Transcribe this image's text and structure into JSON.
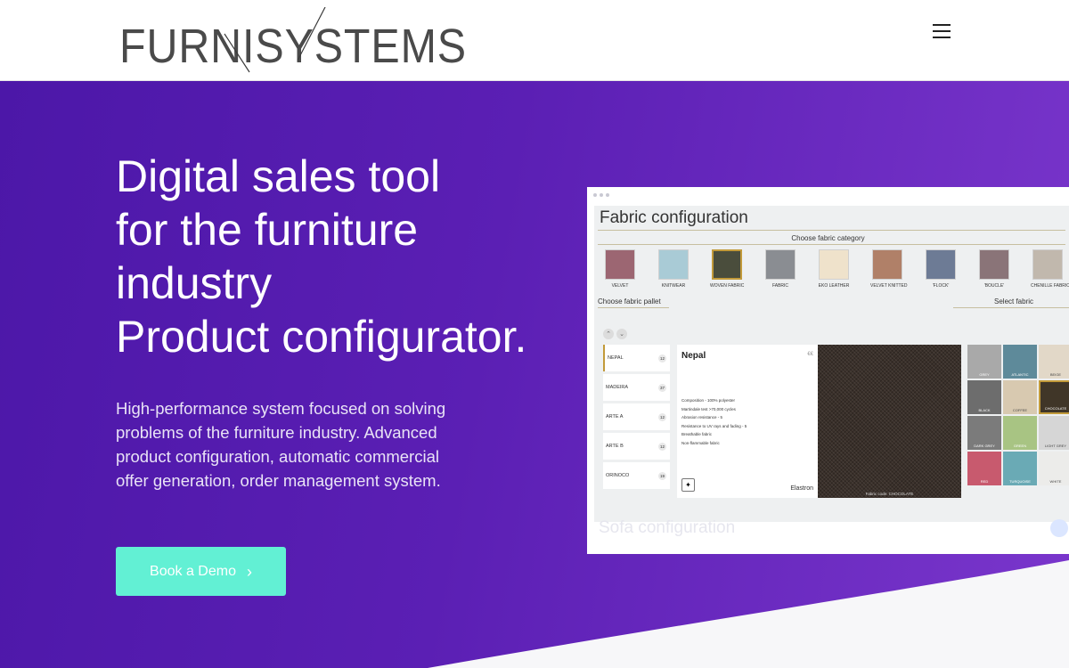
{
  "header": {
    "logo_text": "FURNISYSTEMS",
    "menu_icon": "hamburger-menu-icon"
  },
  "hero": {
    "headline": [
      "Digital sales tool",
      "for the furniture",
      "industry",
      "Product configurator."
    ],
    "description": "High-performance system focused on solving problems of the furniture industry. Advanced product configuration, automatic commercial offer generation, order management system.",
    "cta_label": "Book a Demo",
    "cta_icon": "chevron-right-icon",
    "colors": {
      "gradient_start": "#4c17a8",
      "gradient_end": "#7a36cc",
      "cta": "#62f0d4"
    }
  },
  "mockup": {
    "title": "Fabric configuration",
    "category_title": "Choose fabric category",
    "categories": [
      {
        "label": "VELVET",
        "color": "#9c6672"
      },
      {
        "label": "KNITWEAR",
        "color": "#a9cbd6"
      },
      {
        "label": "WOVEN FABRIC",
        "color": "#4a4d3c"
      },
      {
        "label": "FABRIC",
        "color": "#8a8d92"
      },
      {
        "label": "EKO LEATHER",
        "color": "#efe2cb"
      },
      {
        "label": "VELVET KNITTED",
        "color": "#b08068"
      },
      {
        "label": "'FLOCK'",
        "color": "#6d7b95"
      },
      {
        "label": "'BOUCLE'",
        "color": "#8a7478"
      },
      {
        "label": "CHENILLE FABRIC",
        "color": "#c1b8ad"
      }
    ],
    "pallet_title": "Choose fabric pallet",
    "pallets": [
      {
        "label": "NEPAL",
        "count": "12"
      },
      {
        "label": "MADEIRA",
        "count": "37"
      },
      {
        "label": "ARTE A",
        "count": "12"
      },
      {
        "label": "ARTE B",
        "count": "12"
      },
      {
        "label": "ORINOCO",
        "count": "19"
      }
    ],
    "detail": {
      "name": "Nepal",
      "price": "€€",
      "props": [
        "Composition - 100% polyester",
        "Martindale test >70,000 cycles",
        "Abrasion resistance - 5",
        "Resistance to UV rays and fading - 5",
        "Breathable fabric",
        "Non-flammable fabric"
      ],
      "brand": "Elastron",
      "fabric_caption": "Fabric code: CHOCOLATE"
    },
    "select_title": "Select fabric",
    "swatches": [
      {
        "label": "GREY",
        "color": "#a9a9a9"
      },
      {
        "label": "ATLANTIC",
        "color": "#5e8a9a"
      },
      {
        "label": "BEIGE",
        "color": "#e2d8c8"
      },
      {
        "label": "BLACK",
        "color": "#6d6d6d"
      },
      {
        "label": "COFFEE",
        "color": "#d8c9b0"
      },
      {
        "label": "CHOCOLATE",
        "color": "#403628"
      },
      {
        "label": "DARK GREY",
        "color": "#7b7b7b"
      },
      {
        "label": "GREEN",
        "color": "#a8c483"
      },
      {
        "label": "LIGHT GREY",
        "color": "#d6d6d6"
      },
      {
        "label": "RED",
        "color": "#c85a6e"
      },
      {
        "label": "TURQUOISE",
        "color": "#6aaab5"
      },
      {
        "label": "WHITE",
        "color": "#ececea"
      }
    ],
    "sofa_title": "Sofa configuration"
  }
}
